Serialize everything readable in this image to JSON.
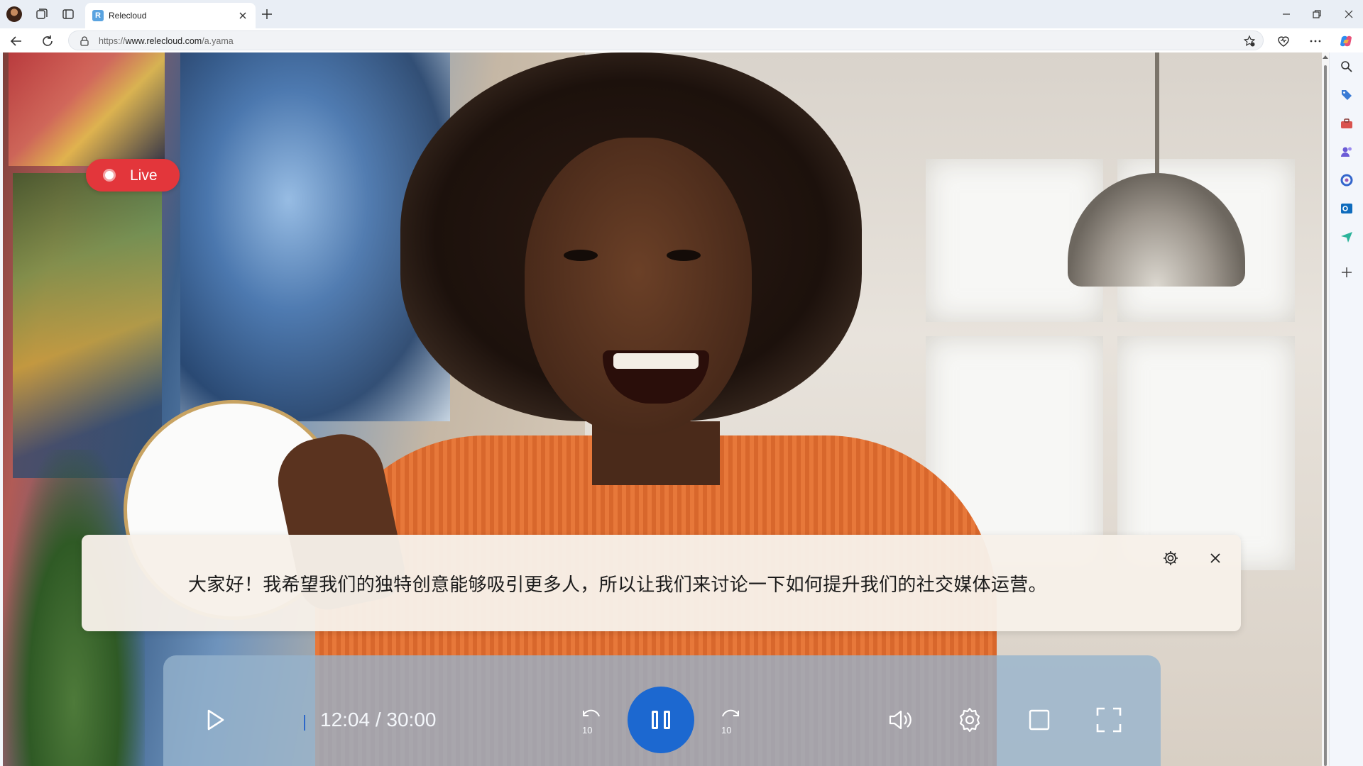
{
  "browser": {
    "tab_title": "Relecloud",
    "tab_favicon_letter": "R",
    "url_prefix": "https://",
    "url_host": "www.relecloud.com",
    "url_path": "/a.yama"
  },
  "icons": {
    "titlebar": [
      "profile-avatar",
      "workspaces-icon",
      "vertical-tabs-icon",
      "close-icon",
      "new-tab-icon",
      "minimize-icon",
      "restore-icon",
      "window-close-icon"
    ],
    "toolbar": [
      "back-icon",
      "refresh-icon",
      "lock-icon",
      "favorite-star-icon",
      "browser-essentials-icon",
      "more-icon",
      "copilot-icon"
    ],
    "sidebar": [
      "search-icon",
      "tag-icon",
      "toolbox-icon",
      "people-icon",
      "m365-icon",
      "outlook-icon",
      "send-icon",
      "add-icon"
    ]
  },
  "video": {
    "live_label": "Live",
    "caption_text": "大家好！我希望我们的独特创意能够吸引更多人，所以让我们来讨论一下如何提升我们的社交媒体运营。",
    "current_time": "12:04",
    "duration": "30:00",
    "time_display": "12:04 / 30:00",
    "skip_back_seconds": "10",
    "skip_forward_seconds": "10",
    "state": "playing"
  },
  "colors": {
    "live_red": "#e3363b",
    "pause_button_blue": "#1c68d0",
    "caption_background": "#f7f0e9"
  }
}
